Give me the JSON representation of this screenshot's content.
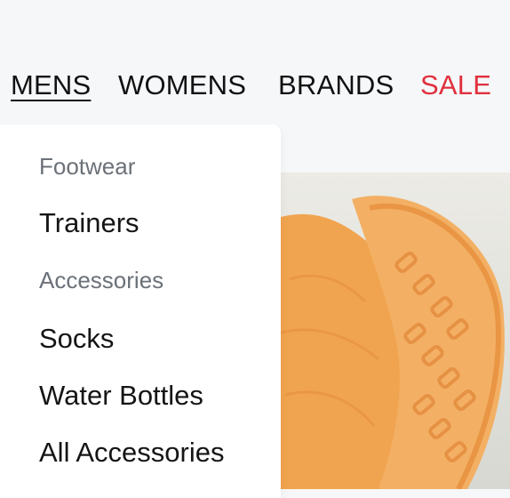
{
  "nav": {
    "items": [
      {
        "label": "MENS",
        "active": true
      },
      {
        "label": "WOMENS",
        "active": false
      },
      {
        "label": "BRANDS",
        "active": false
      },
      {
        "label": "SALE",
        "active": false
      }
    ]
  },
  "dropdown": {
    "sections": [
      {
        "heading": "Footwear",
        "links": [
          "Trainers"
        ]
      },
      {
        "heading": "Accessories",
        "links": [
          "Socks",
          "Water Bottles",
          "All Accessories"
        ]
      }
    ]
  },
  "colors": {
    "sale": "#e0303d",
    "heading": "#6b7178",
    "background": "#f6f7f9",
    "shoe": "#f0a24e"
  },
  "hero": {
    "icon": "trainer-shoe-image"
  }
}
